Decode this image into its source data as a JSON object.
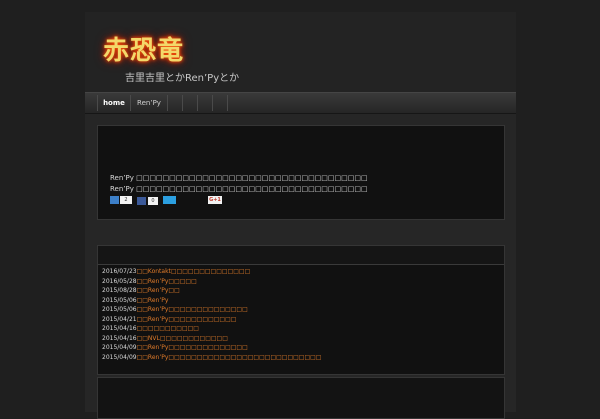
{
  "site": {
    "logo_text": "赤恐竜",
    "tagline": "吉里吉里とかRen’Pyとか"
  },
  "nav": {
    "items": [
      {
        "label": "home",
        "active": true
      },
      {
        "label": "Ren’Py",
        "active": false
      }
    ]
  },
  "intro": {
    "line1": "Ren’Py □□□□□□□□□□□□□□□□□□□□□□□□□□□□□□□□□□□",
    "line2": "Ren’Py □□□□□□□□□□□□□□□□□□□□□□□□□□□□□□□□□□□",
    "hatena_count": "2",
    "facebook_count": "0",
    "twitter_label": "",
    "gplus_label": "G+1"
  },
  "news": {
    "items": [
      {
        "date": "2016/07/23",
        "text": "□□Kontakt□□□□□□□□□□□□□□"
      },
      {
        "date": "2016/05/28",
        "text": "□□Ren’Py□□□□□"
      },
      {
        "date": "2015/08/28",
        "text": "□□Ren’Py□□"
      },
      {
        "date": "2015/05/06",
        "text": "□□Ren’Py"
      },
      {
        "date": "2015/05/06",
        "text": "□□Ren’Py□□□□□□□□□□□□□□"
      },
      {
        "date": "2015/04/21",
        "text": "□□Ren’Py□□□□□□□□□□□□"
      },
      {
        "date": "2015/04/16",
        "text": "□□□□□□□□□□□"
      },
      {
        "date": "2015/04/16",
        "text": "□□NVL□□□□□□□□□□□□"
      },
      {
        "date": "2015/04/09",
        "text": "□□Ren’Py□□□□□□□□□□□□□□"
      },
      {
        "date": "2015/04/09",
        "text": "□□Ren’Py□□□□□□□□□□□□□□□□□□□□□□□□□□□"
      }
    ]
  },
  "colors": {
    "accent": "#e07b2a",
    "background": "#1f1f1f",
    "panel": "#111111"
  }
}
